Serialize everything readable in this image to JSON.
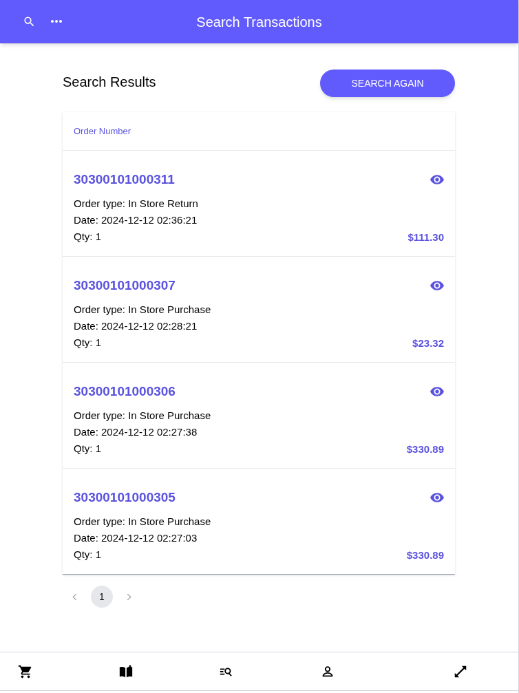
{
  "app_bar": {
    "title": "Search Transactions"
  },
  "heading": "Search Results",
  "search_again_button": "SEARCH AGAIN",
  "table": {
    "columns": [
      "Order Number"
    ],
    "rows": [
      {
        "order_number": "30300101000311",
        "order_type": "Order type: In Store Return",
        "date": "Date: 2024-12-12 02:36:21",
        "qty": "Qty: 1",
        "total": "$111.30"
      },
      {
        "order_number": "30300101000307",
        "order_type": "Order type: In Store Purchase",
        "date": "Date: 2024-12-12 02:28:21",
        "qty": "Qty: 1",
        "total": "$23.32"
      },
      {
        "order_number": "30300101000306",
        "order_type": "Order type: In Store Purchase",
        "date": "Date: 2024-12-12 02:27:38",
        "qty": "Qty: 1",
        "total": "$330.89"
      },
      {
        "order_number": "30300101000305",
        "order_type": "Order type: In Store Purchase",
        "date": "Date: 2024-12-12 02:27:03",
        "qty": "Qty: 1",
        "total": "$330.89"
      }
    ]
  },
  "pagination": {
    "pages": [
      {
        "label": "1",
        "selected": true
      }
    ]
  }
}
